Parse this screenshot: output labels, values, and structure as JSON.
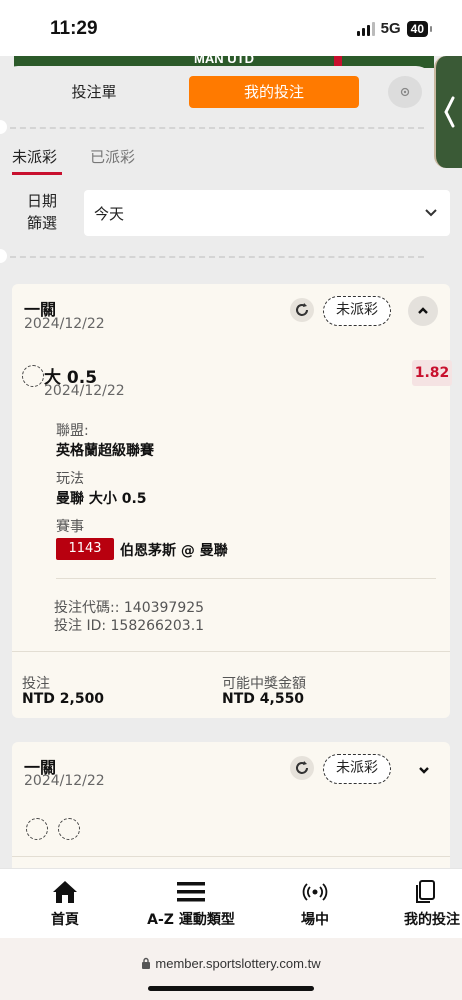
{
  "status_bar": {
    "time": "11:29",
    "network": "5G",
    "battery": "40"
  },
  "banner": {
    "text": "MAN UTD"
  },
  "tabs": {
    "bet_slip": "投注單",
    "my_bets": "我的投注"
  },
  "sub_tabs": {
    "unsettled": "未派彩",
    "settled": "已派彩"
  },
  "date_filter": {
    "label": "日期篩選",
    "value": "今天"
  },
  "bets": [
    {
      "type": "一關",
      "date": "2024/12/22",
      "status": "未派彩",
      "selection": {
        "name": "大 0.5",
        "date": "2024/12/22",
        "odds": "1.82",
        "league_label": "聯盟:",
        "league": "英格蘭超級聯賽",
        "market_label": "玩法",
        "market": "曼聯 大小 0.5",
        "event_label": "賽事",
        "match_code": "1143",
        "match": "伯恩茅斯 @ 曼聯"
      },
      "bet_code": "投注代碼:: 140397925",
      "bet_id": "投注 ID: 158266203.1",
      "stake_label": "投注",
      "stake": "NTD 2,500",
      "payout_label": "可能中獎金額",
      "payout": "NTD 4,550"
    },
    {
      "type": "一關",
      "date": "2024/12/22",
      "status": "未派彩"
    }
  ],
  "nav": [
    {
      "label": "首頁",
      "icon": "home-icon"
    },
    {
      "label": "A-Z 運動類型",
      "icon": "menu-icon"
    },
    {
      "label": "場中",
      "icon": "live-icon"
    },
    {
      "label": "我的投注",
      "icon": "bets-icon"
    }
  ],
  "browser": {
    "url": "member.sportslottery.com.tw"
  },
  "colors": {
    "accent": "#ff7a00",
    "red": "#c8102e",
    "card_bg": "#fbf8f1"
  }
}
